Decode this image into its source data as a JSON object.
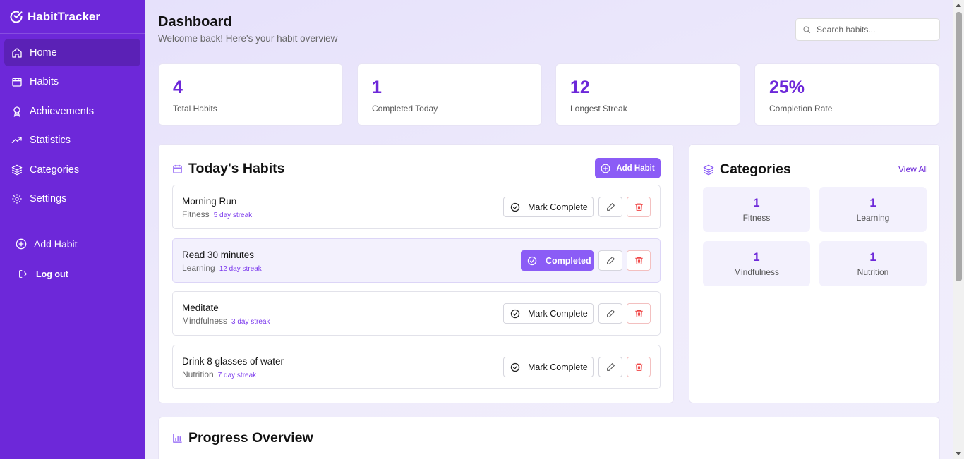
{
  "brand": "HabitTracker",
  "sidebar": {
    "items": [
      {
        "label": "Home",
        "icon": "home-icon",
        "active": true
      },
      {
        "label": "Habits",
        "icon": "calendar-icon"
      },
      {
        "label": "Achievements",
        "icon": "award-icon"
      },
      {
        "label": "Statistics",
        "icon": "trending-up-icon"
      },
      {
        "label": "Categories",
        "icon": "layers-icon"
      },
      {
        "label": "Settings",
        "icon": "gear-icon"
      }
    ],
    "add_habit": "Add Habit",
    "logout": "Log out"
  },
  "header": {
    "title": "Dashboard",
    "subtitle": "Welcome back! Here's your habit overview"
  },
  "search": {
    "placeholder": "Search habits..."
  },
  "stats": [
    {
      "value": "4",
      "label": "Total Habits"
    },
    {
      "value": "1",
      "label": "Completed Today"
    },
    {
      "value": "12",
      "label": "Longest Streak"
    },
    {
      "value": "25%",
      "label": "Completion Rate"
    }
  ],
  "today": {
    "title": "Today's Habits",
    "add_button": "Add Habit",
    "habits": [
      {
        "name": "Morning Run",
        "category": "Fitness",
        "streak": "5 day streak",
        "action": "Mark Complete",
        "completed": false
      },
      {
        "name": "Read 30 minutes",
        "category": "Learning",
        "streak": "12 day streak",
        "action": "Completed",
        "completed": true
      },
      {
        "name": "Meditate",
        "category": "Mindfulness",
        "streak": "3 day streak",
        "action": "Mark Complete",
        "completed": false
      },
      {
        "name": "Drink 8 glasses of water",
        "category": "Nutrition",
        "streak": "7 day streak",
        "action": "Mark Complete",
        "completed": false
      }
    ]
  },
  "categories": {
    "title": "Categories",
    "view_all": "View All",
    "items": [
      {
        "count": "1",
        "name": "Fitness"
      },
      {
        "count": "1",
        "name": "Learning"
      },
      {
        "count": "1",
        "name": "Mindfulness"
      },
      {
        "count": "1",
        "name": "Nutrition"
      }
    ]
  },
  "progress": {
    "title": "Progress Overview"
  },
  "colors": {
    "accent": "#6d28d9",
    "accent_light": "#8b5cf6",
    "danger": "#ef4444"
  }
}
